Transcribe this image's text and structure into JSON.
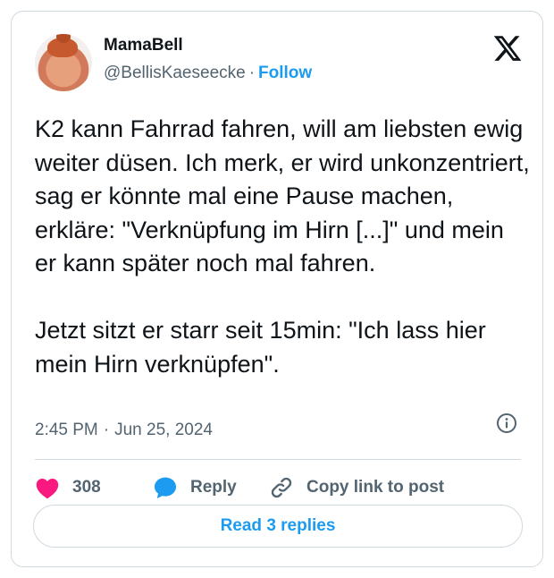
{
  "author": {
    "name": "MamaBell",
    "handle": "@BellisKaeseecke",
    "separator": "·",
    "follow_label": "Follow"
  },
  "tweet": {
    "text": "K2 kann Fahrrad fahren, will am liebsten ewig weiter düsen. Ich merk, er wird unkonzentriert, sag er könnte mal eine Pause machen, erkläre: \"Verknüpfung im Hirn [...]\" und mein er kann später noch mal fahren.\n\nJetzt sitzt er starr seit 15min: \"Ich lass hier mein Hirn verknüpfen\"."
  },
  "meta": {
    "time": "2:45 PM",
    "separator": "·",
    "date": "Jun 25, 2024"
  },
  "actions": {
    "like_count": "308",
    "reply_label": "Reply",
    "copy_label": "Copy link to post"
  },
  "replies_button": {
    "label": "Read 3 replies"
  },
  "icons": {
    "logo": "x-logo-icon",
    "info": "info-icon",
    "like": "heart-icon",
    "reply": "speech-bubble-icon",
    "copy": "link-icon"
  },
  "colors": {
    "accent": "#1d9bf0",
    "like": "#f91880",
    "text": "#0f1419",
    "muted": "#536471",
    "border": "#cfd9de"
  }
}
